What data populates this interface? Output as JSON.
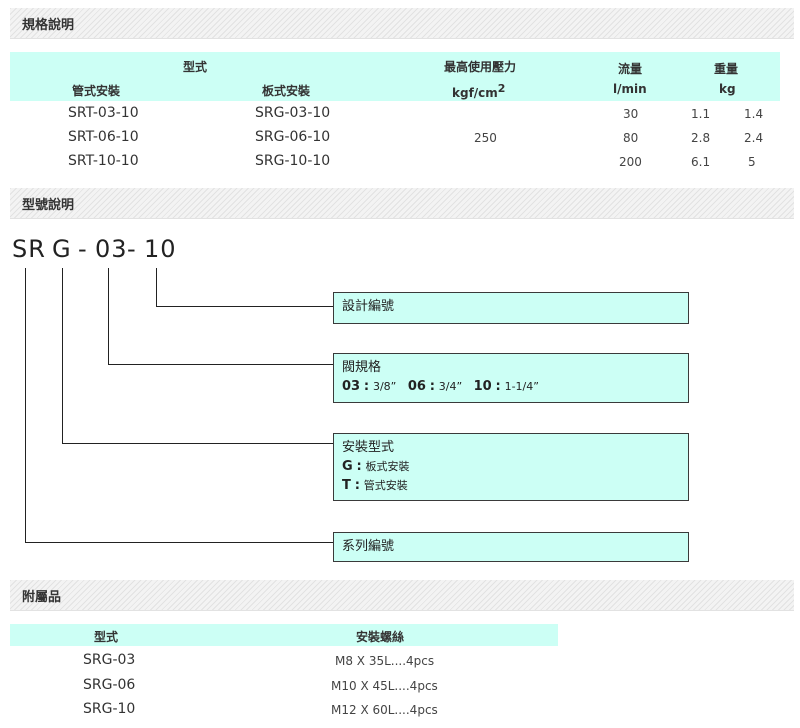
{
  "sections": {
    "specs": "規格說明",
    "model": "型號說明",
    "accessories": "附屬品"
  },
  "spec_table": {
    "headers": {
      "model": "型式",
      "pipe": "管式安裝",
      "plate": "板式安裝",
      "pressure": "最高使用壓力",
      "pressure_unit": "kgf/cm",
      "pressure_sup": "2",
      "flow": "流量",
      "flow_unit": "l/min",
      "weight": "重量",
      "weight_unit": "kg"
    },
    "pressure_value": "250",
    "rows": [
      {
        "pipe": "SRT-03-10",
        "plate": "SRG-03-10",
        "flow": "30",
        "w1": "1.1",
        "w2": "1.4"
      },
      {
        "pipe": "SRT-06-10",
        "plate": "SRG-06-10",
        "flow": "80",
        "w1": "2.8",
        "w2": "2.4"
      },
      {
        "pipe": "SRT-10-10",
        "plate": "SRG-10-10",
        "flow": "200",
        "w1": "6.1",
        "w2": "5"
      }
    ]
  },
  "model_code": {
    "p1": "SR",
    "p2": "G",
    "d1": "-",
    "p3": "03",
    "d2": "-",
    "p4": "10"
  },
  "callouts": {
    "design": {
      "title": "設計編號"
    },
    "size": {
      "title": "閥規格",
      "o1_code": "03",
      "sep": ":",
      "o1_val": "3/8”",
      "o2_code": "06",
      "o2_val": "3/4”",
      "o3_code": "10",
      "o3_val": "1-1/4”"
    },
    "mount": {
      "title": "安裝型式",
      "g_code": "G",
      "g_sep": ":",
      "g_val": "板式安裝",
      "t_code": "T",
      "t_sep": ":",
      "t_val": "管式安裝"
    },
    "series": {
      "title": "系列編號"
    }
  },
  "acc_table": {
    "headers": {
      "model": "型式",
      "bolt": "安裝螺絲"
    },
    "rows": [
      {
        "model": "SRG-03",
        "bolt": "M8 X 35L....4pcs"
      },
      {
        "model": "SRG-06",
        "bolt": "M10 X 45L....4pcs"
      },
      {
        "model": "SRG-10",
        "bolt": "M12 X 60L....4pcs"
      }
    ]
  }
}
